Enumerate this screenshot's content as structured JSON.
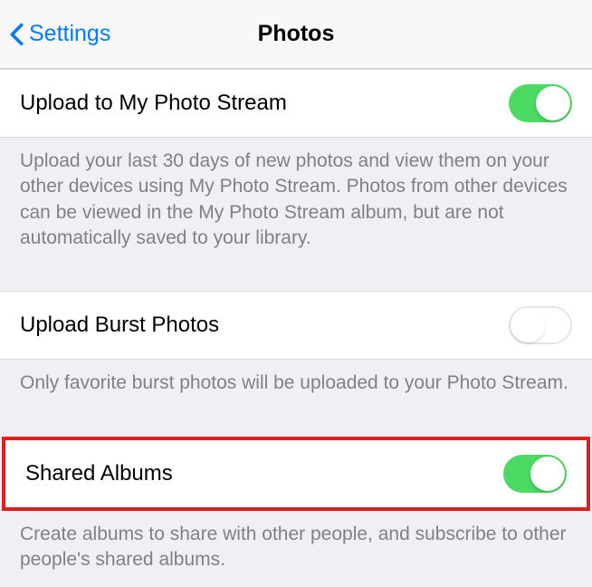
{
  "header": {
    "back_label": "Settings",
    "title": "Photos"
  },
  "rows": {
    "photo_stream": {
      "label": "Upload to My Photo Stream",
      "description": "Upload your last 30 days of new photos and view them on your other devices using My Photo Stream. Photos from other devices can be viewed in the My Photo Stream album, but are not automatically saved to your library."
    },
    "burst": {
      "label": "Upload Burst Photos",
      "description": "Only favorite burst photos will be uploaded to your Photo Stream."
    },
    "shared": {
      "label": "Shared Albums",
      "description": "Create albums to share with other people, and subscribe to other people's shared albums."
    }
  }
}
